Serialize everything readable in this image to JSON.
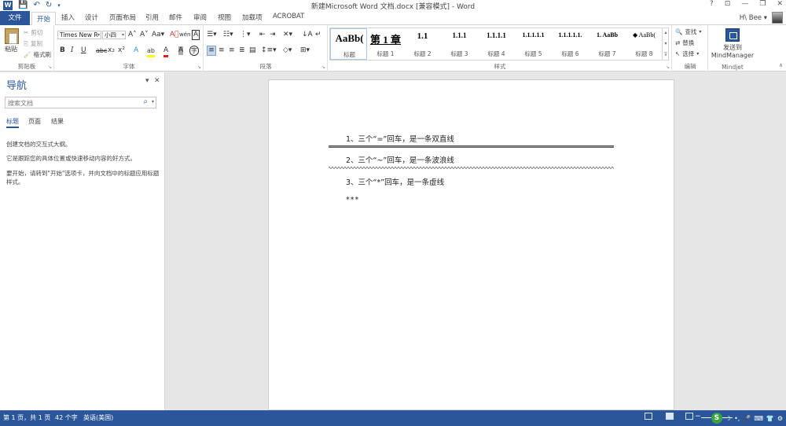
{
  "window": {
    "title": "新建Microsoft Word 文档.docx [兼容模式] - Word",
    "controls": {
      "help": "?",
      "ribbon_opts": "⊡",
      "minimize": "—",
      "restore": "❐",
      "close": "✕"
    }
  },
  "quick_access": {
    "icons": [
      "word-logo-icon",
      "save-icon",
      "undo-icon",
      "redo-icon",
      "customize-icon"
    ]
  },
  "tabs": {
    "file": "文件",
    "items": [
      "开始",
      "插入",
      "设计",
      "页面布局",
      "引用",
      "邮件",
      "审阅",
      "视图",
      "加载项",
      "ACROBAT"
    ],
    "active": "开始"
  },
  "user": {
    "name": "H\\ Bee ▾"
  },
  "ribbon": {
    "clipboard": {
      "label": "剪贴板",
      "paste": "粘贴",
      "cut": "剪切",
      "copy": "复制",
      "format_painter": "格式刷"
    },
    "font": {
      "label": "字体",
      "font_name": "Times New R",
      "font_size": "小四",
      "grow": "A˄",
      "shrink": "A˅",
      "case": "Aa▾",
      "clear": "A⃠",
      "phonetic": "wén",
      "border": "A",
      "bold": "B",
      "italic": "I",
      "underline": "U",
      "strike": "abc",
      "sub": "x₂",
      "sup": "x²",
      "effects": "A",
      "highlight": "ab",
      "color": "A",
      "shade": "A",
      "circle": "字"
    },
    "paragraph": {
      "label": "段落"
    },
    "styles": {
      "label": "样式",
      "items": [
        {
          "sample": "AaBb(",
          "name": "标题"
        },
        {
          "sample": "第 1 章",
          "name": "标题 1"
        },
        {
          "sample": "1.1",
          "name": "标题 2"
        },
        {
          "sample": "1.1.1",
          "name": "标题 3"
        },
        {
          "sample": "1.1.1.1",
          "name": "标题 4"
        },
        {
          "sample": "1.1.1.1.1",
          "name": "标题 5"
        },
        {
          "sample": "1.1.1.1.1.",
          "name": "标题 6"
        },
        {
          "sample": "1. AaBb",
          "name": "标题 7"
        },
        {
          "sample": "◆ AaBb(",
          "name": "标题 8"
        }
      ]
    },
    "editing": {
      "label": "编辑",
      "find": "查找",
      "replace": "替换",
      "select": "选择"
    },
    "mindjet": {
      "label": "Mindjet",
      "send": "发送到",
      "mindmanager": "MindManager"
    }
  },
  "nav_pane": {
    "title": "导航",
    "search_placeholder": "搜索文档",
    "tabs": [
      "标题",
      "页面",
      "结果"
    ],
    "active_tab": "标题",
    "hint1": "创建文档的交互式大纲。",
    "hint2": "它是跟踪您的具体位置或快速移动内容的好方式。",
    "hint3": "要开始，请转到\"开始\"选项卡，并向文档中的标题应用标题样式。"
  },
  "document": {
    "lines": [
      "1、三个“=”回车，是一条双直线",
      "2、三个“~”回车，是一条波浪线",
      "3、三个“*”回车，是一条虚线"
    ],
    "typed": "***"
  },
  "status": {
    "page": "第 1 页，共 1 页",
    "words": "42 个字",
    "language": "英语(美国)",
    "zoom_level": 0.45
  },
  "tray": {
    "items": [
      "S",
      "☽",
      "•,",
      "🎤",
      "⌨",
      "👕",
      "⚙"
    ]
  },
  "colors": {
    "accent": "#2b579a",
    "status_bg": "#2b579a"
  }
}
